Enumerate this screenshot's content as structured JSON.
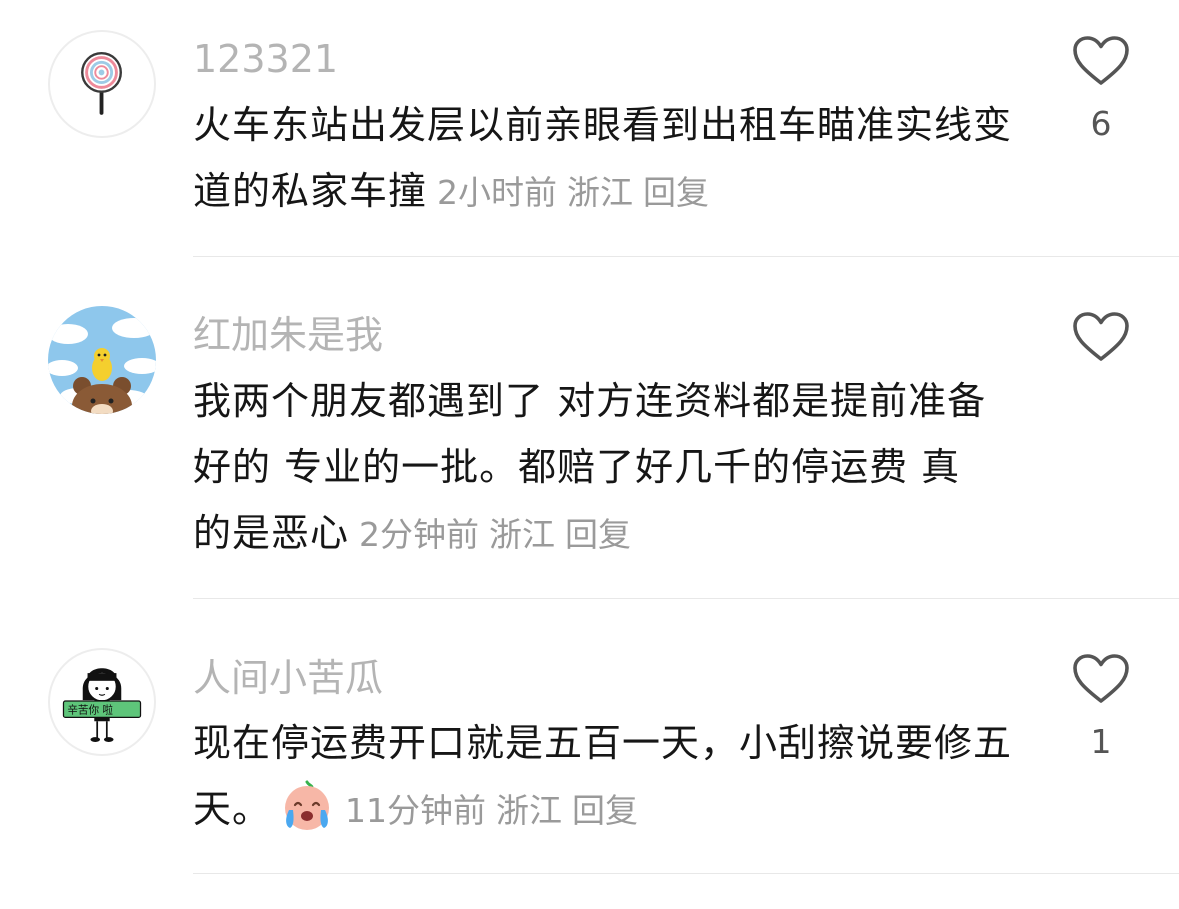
{
  "comments": [
    {
      "username": "123321",
      "text": "火车东站出发层以前亲眼看到出租车瞄准实线变道的私家车撞",
      "time": "2小时前",
      "location": "浙江",
      "reply_label": "回复",
      "like_count": "6"
    },
    {
      "username": "红加朱是我",
      "text": "我两个朋友都遇到了 对方连资料都是提前准备好的 专业的一批。都赔了好几千的停运费 真的是恶心",
      "time": "2分钟前",
      "location": "浙江",
      "reply_label": "回复",
      "like_count": ""
    },
    {
      "username": "人间小苦瓜",
      "text": "现在停运费开口就是五百一天，小刮擦说要修五天。",
      "time": "11分钟前",
      "location": "浙江",
      "reply_label": "回复",
      "like_count": "1",
      "avatar_sign_text": "辛苦你 啦"
    }
  ],
  "icons": {
    "like": "heart-outline-icon",
    "emoji": "crying-face-emoji"
  },
  "colors": {
    "username": "#b4b4b4",
    "text": "#161616",
    "meta": "#9a9a9a",
    "divider": "#e8e8e8",
    "icon": "#555555"
  }
}
